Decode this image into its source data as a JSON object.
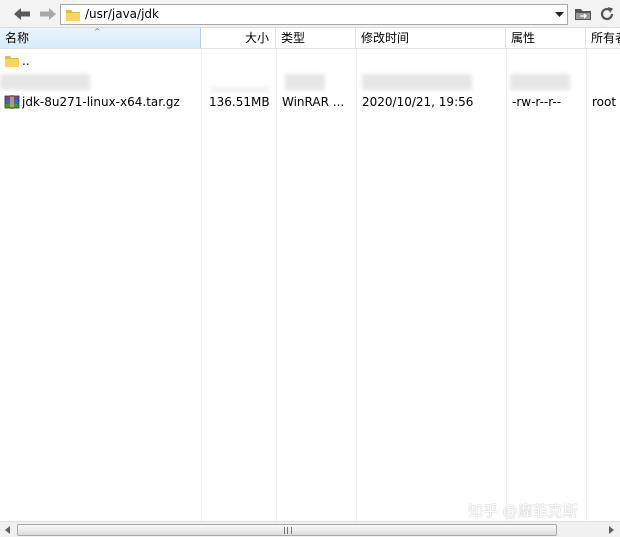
{
  "toolbar": {
    "path": "/usr/java/jdk"
  },
  "columns": {
    "name": "名称",
    "size": "大小",
    "type": "类型",
    "modified": "修改时间",
    "attributes": "属性",
    "owner": "所有者"
  },
  "files": [
    {
      "name": "..",
      "size": "",
      "type": "",
      "modified": "",
      "attributes": "",
      "owner": "",
      "icon": "folder-icon"
    },
    {
      "name": "jdk-8u271-linux-x64.tar.gz",
      "size": "136.51MB",
      "type": "WinRAR ...",
      "modified": "2020/10/21, 19:56",
      "attributes": "-rw-r--r--",
      "owner": "root",
      "icon": "winrar-archive-icon"
    }
  ],
  "watermark": "知乎 @靡菲克斯",
  "colors": {
    "sorted_header": "#d7ecfa",
    "folder": "#f2c94c"
  }
}
